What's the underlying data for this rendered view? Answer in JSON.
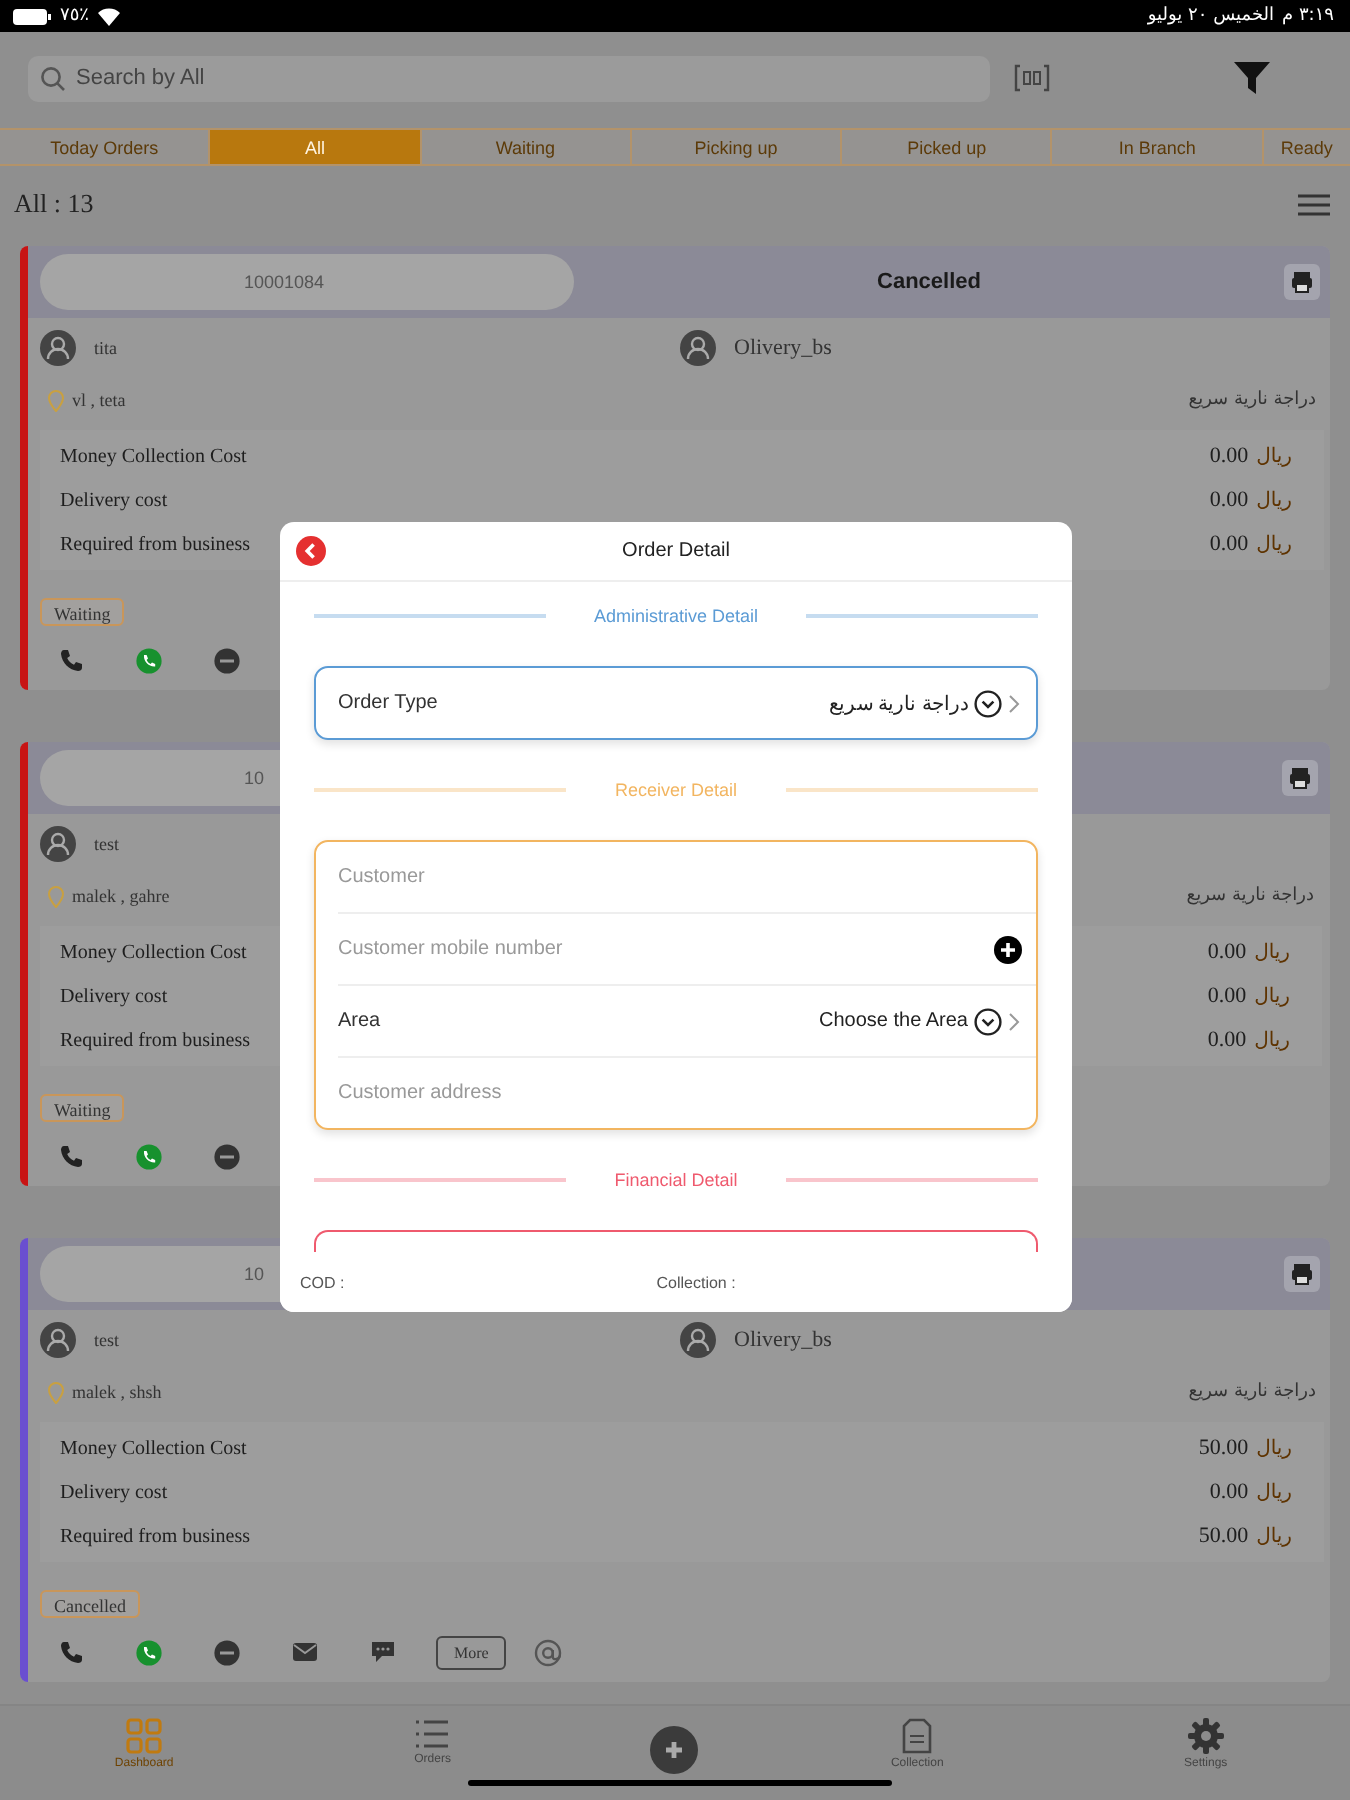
{
  "status_bar": {
    "battery": "٧٥٪",
    "time": "٣:١٩ م",
    "date": "الخميس ٢٠ يوليو"
  },
  "search": {
    "placeholder": "Search by All"
  },
  "filter_tabs": [
    {
      "label": "Today Orders",
      "selected": false
    },
    {
      "label": "All",
      "selected": true
    },
    {
      "label": "Waiting",
      "selected": false
    },
    {
      "label": "Picking up",
      "selected": false
    },
    {
      "label": "Picked up",
      "selected": false
    },
    {
      "label": "In Branch",
      "selected": false
    },
    {
      "label": "Ready",
      "selected": false
    }
  ],
  "count_label": "All : 13",
  "orders": [
    {
      "color": "#c81414",
      "order_id": "10001084",
      "status": "Cancelled",
      "sender": "tita",
      "driver": "Olivery_bs",
      "location": "vl , teta",
      "order_type": "دراجة نارية سريع",
      "costs": [
        {
          "label": "Money Collection Cost",
          "amount": "0.00",
          "currency": "ريال"
        },
        {
          "label": "Delivery cost",
          "amount": "0.00",
          "currency": "ريال"
        },
        {
          "label": "Required from business",
          "amount": "0.00",
          "currency": "ريال"
        }
      ],
      "tag": "Waiting",
      "actions": [
        {
          "kind": "phone"
        },
        {
          "kind": "whatsapp"
        },
        {
          "kind": "message"
        }
      ]
    },
    {
      "color": "#c81414",
      "order_id": "10",
      "sender": "test",
      "location": "malek , gahre",
      "order_type": "دراجة نارية سريع",
      "costs": [
        {
          "label": "Money Collection Cost",
          "amount": "0.00",
          "currency": "ريال"
        },
        {
          "label": "Delivery cost",
          "amount": "0.00",
          "currency": "ريال"
        },
        {
          "label": "Required from business",
          "amount": "0.00",
          "currency": "ريال"
        }
      ],
      "tag": "Waiting",
      "actions": [
        {
          "kind": "phone"
        },
        {
          "kind": "whatsapp"
        },
        {
          "kind": "message"
        }
      ]
    },
    {
      "color": "#6a4fd0",
      "order_id": "10",
      "sender": "test",
      "driver": "Olivery_bs",
      "location": "malek , shsh",
      "order_type": "دراجة نارية سريع",
      "costs": [
        {
          "label": "Money Collection Cost",
          "amount": "50.00",
          "currency": "ريال"
        },
        {
          "label": "Delivery cost",
          "amount": "0.00",
          "currency": "ريال"
        },
        {
          "label": "Required from business",
          "amount": "50.00",
          "currency": "ريال"
        }
      ],
      "tag": "Cancelled",
      "actions": [
        {
          "kind": "phone"
        },
        {
          "kind": "whatsapp"
        },
        {
          "kind": "message"
        },
        {
          "kind": "mail"
        },
        {
          "kind": "chat"
        },
        {
          "kind": "more",
          "label": "More"
        },
        {
          "kind": "mention"
        }
      ]
    }
  ],
  "modal": {
    "title": "Order Detail",
    "sections": [
      {
        "title": "Administrative Detail",
        "color": "#5b9bd5",
        "fields": [
          {
            "kind": "select",
            "label": "Order Type",
            "value": "دراجة نارية سريع"
          }
        ]
      },
      {
        "title": "Receiver Detail",
        "color": "#f2b560",
        "fields": [
          {
            "kind": "text",
            "placeholder": "Customer"
          },
          {
            "kind": "phone",
            "placeholder": "Customer mobile number"
          },
          {
            "kind": "select",
            "label": "Area",
            "value": "Choose the Area"
          },
          {
            "kind": "text",
            "placeholder": "Customer address"
          }
        ]
      },
      {
        "title": "Financial Detail",
        "color": "#ef5a6e"
      }
    ],
    "footer": [
      "COD :",
      "Collection :"
    ]
  },
  "bottom_nav": [
    {
      "kind": "dashboard",
      "label": "Dashboard",
      "selected": true
    },
    {
      "kind": "orders",
      "label": "Orders",
      "selected": false
    },
    {
      "kind": "add"
    },
    {
      "kind": "collection",
      "label": "Collection",
      "selected": false
    },
    {
      "kind": "settings",
      "label": "Settings",
      "selected": false
    }
  ]
}
